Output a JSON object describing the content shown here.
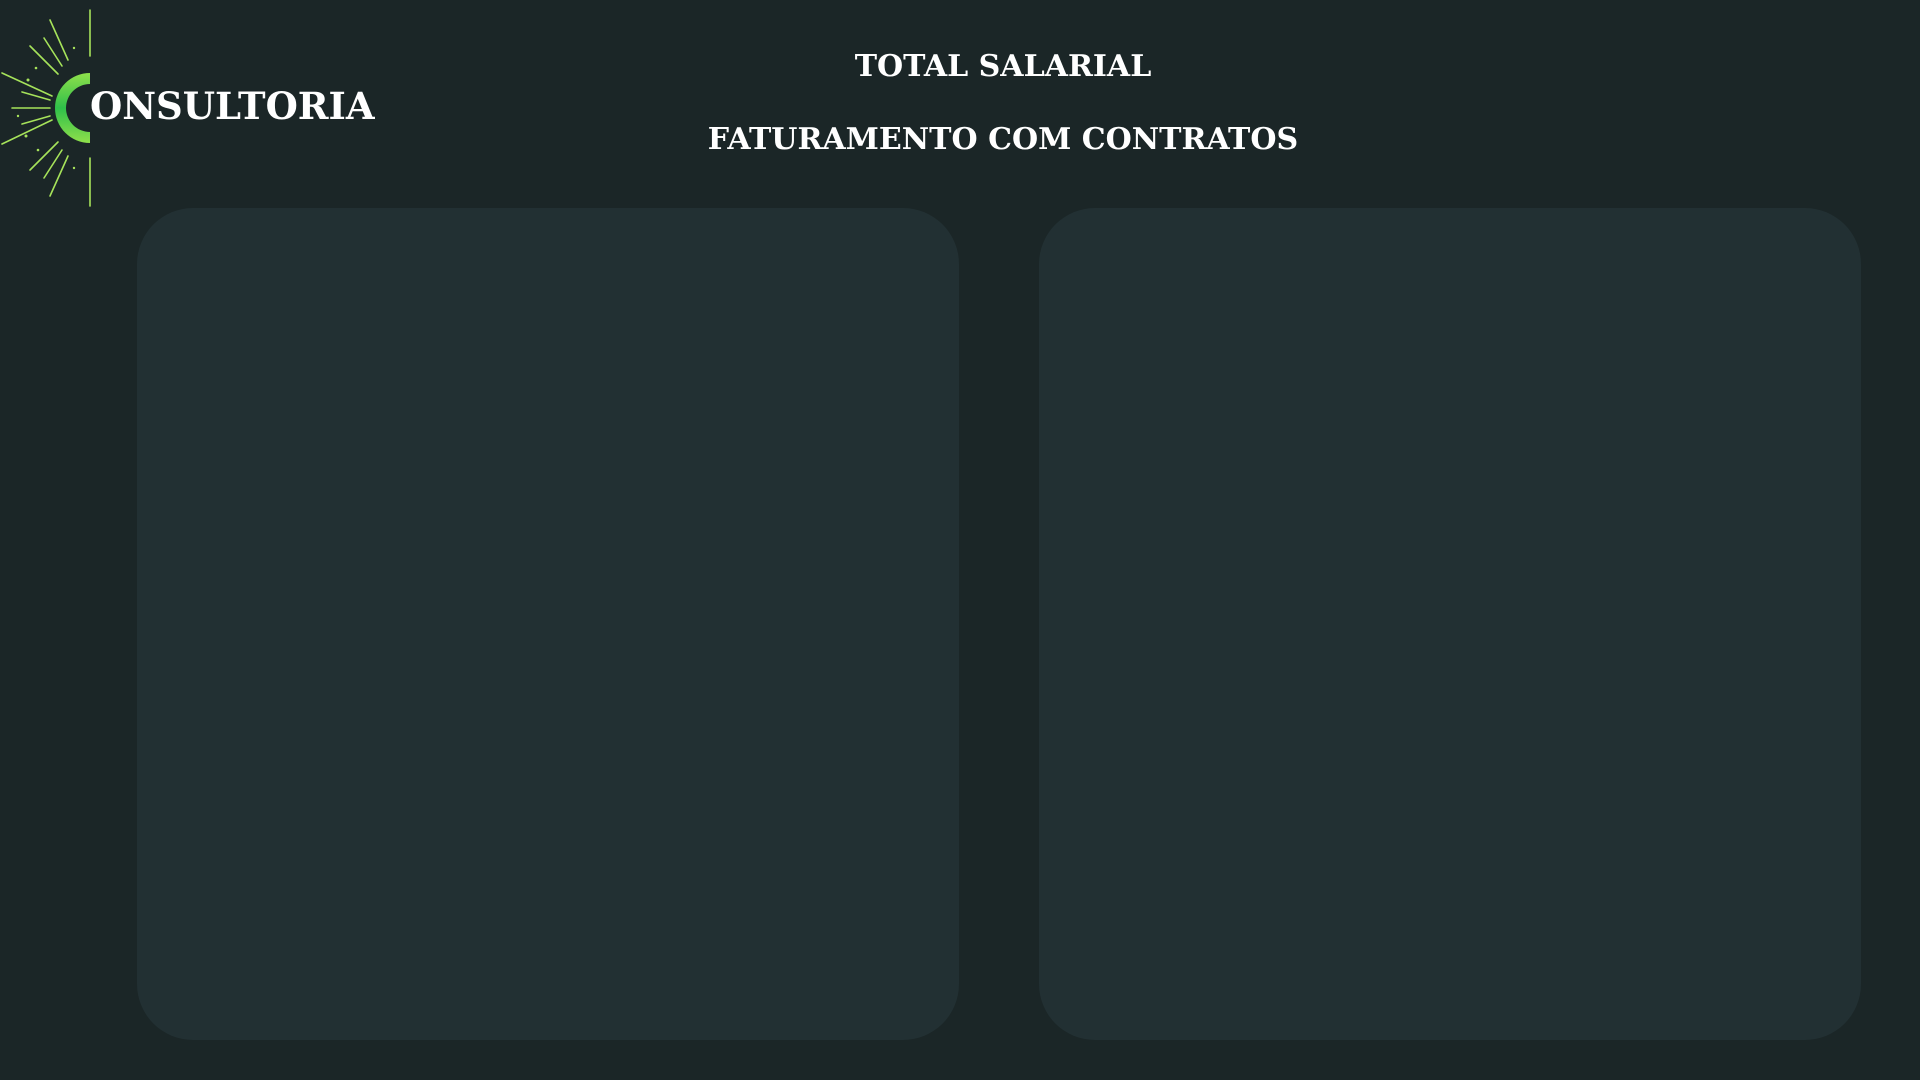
{
  "brand": {
    "logo_text": "ONSULTORIA",
    "colors": {
      "arc_start": "#2fbf4a",
      "arc_end": "#8fe04b",
      "rays": "#a6e35a"
    }
  },
  "header": {
    "title_1": "TOTAL SALARIAL",
    "title_2": "FATURAMENTO COM CONTRATOS"
  },
  "panels": {
    "left": {
      "content": ""
    },
    "right": {
      "content": ""
    }
  },
  "theme": {
    "background": "#1b2627",
    "panel": "#223033",
    "text": "#ffffff"
  }
}
